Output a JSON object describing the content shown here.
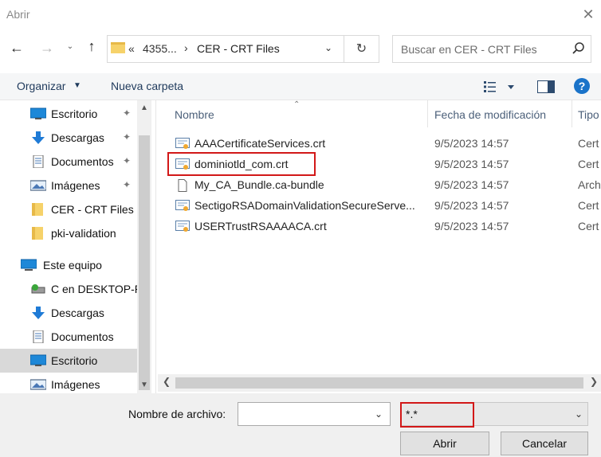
{
  "window": {
    "title": "Abrir",
    "close_glyph": "✕"
  },
  "nav": {
    "back_glyph": "←",
    "forward_glyph": "→",
    "recent_glyph": "⌄",
    "up_glyph": "↑"
  },
  "address": {
    "prefix": "«",
    "segments": [
      "4355...",
      "CER - CRT Files"
    ],
    "separator": "›",
    "dropdown_glyph": "⌄",
    "refresh_glyph": "↻"
  },
  "search": {
    "placeholder": "Buscar en CER - CRT Files",
    "icon": "search-icon"
  },
  "toolbar": {
    "organize_label": "Organizar",
    "organize_arrow": "▼",
    "new_folder_label": "Nueva carpeta",
    "help_label": "?"
  },
  "sidebar": {
    "items": [
      {
        "label": "Escritorio",
        "icon": "desktop-icon",
        "pinned": true
      },
      {
        "label": "Descargas",
        "icon": "download-icon",
        "pinned": true
      },
      {
        "label": "Documentos",
        "icon": "documents-icon",
        "pinned": true
      },
      {
        "label": "Imágenes",
        "icon": "pictures-icon",
        "pinned": true
      },
      {
        "label": "CER - CRT Files",
        "icon": "folder-icon",
        "pinned": false
      },
      {
        "label": "pki-validation",
        "icon": "folder-icon",
        "pinned": false
      },
      {
        "label": "Este equipo",
        "icon": "computer-icon",
        "pinned": false
      },
      {
        "label": "C en DESKTOP-P",
        "icon": "network-drive-icon",
        "pinned": false
      },
      {
        "label": "Descargas",
        "icon": "download-icon",
        "pinned": false
      },
      {
        "label": "Documentos",
        "icon": "documents-icon",
        "pinned": false
      },
      {
        "label": "Escritorio",
        "icon": "desktop-icon",
        "pinned": false,
        "selected": true
      },
      {
        "label": "Imágenes",
        "icon": "pictures-icon",
        "pinned": false
      }
    ],
    "pin_glyph": "📌"
  },
  "file_list": {
    "columns": [
      "Nombre",
      "Fecha de modificación",
      "Tipo"
    ],
    "rows": [
      {
        "name": "AAACertificateServices.crt",
        "date": "9/5/2023 14:57",
        "type": "Cert",
        "icon": "certificate-icon"
      },
      {
        "name": "dominiotld_com.crt",
        "date": "9/5/2023 14:57",
        "type": "Cert",
        "icon": "certificate-icon"
      },
      {
        "name": "My_CA_Bundle.ca-bundle",
        "date": "9/5/2023 14:57",
        "type": "Arch",
        "icon": "file-icon"
      },
      {
        "name": "SectigoRSADomainValidationSecureServe...",
        "date": "9/5/2023 14:57",
        "type": "Cert",
        "icon": "certificate-icon"
      },
      {
        "name": "USERTrustRSAAAACA.crt",
        "date": "9/5/2023 14:57",
        "type": "Cert",
        "icon": "certificate-icon"
      }
    ]
  },
  "footer": {
    "filename_label": "Nombre de archivo:",
    "filename_value": "",
    "filter_value": "*.*",
    "open_label": "Abrir",
    "cancel_label": "Cancelar"
  },
  "colors": {
    "highlight": "#d21818",
    "accent": "#1a73c9"
  }
}
